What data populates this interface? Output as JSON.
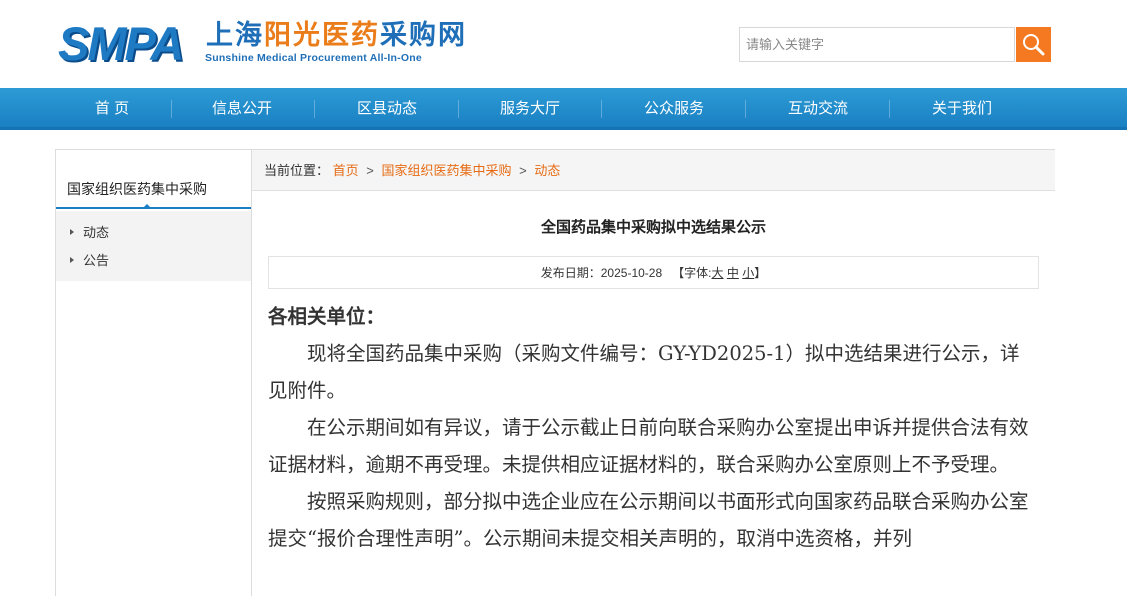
{
  "logo": {
    "abbr": "SMPA",
    "cn_part1": "上海",
    "cn_part2": "阳光医药",
    "cn_part3": "采购网",
    "en": "Sunshine Medical Procurement All-In-One"
  },
  "search": {
    "placeholder": "请输入关键字",
    "button_icon": "search-icon"
  },
  "nav": {
    "items": [
      "首 页",
      "信息公开",
      "区县动态",
      "服务大厅",
      "公众服务",
      "互动交流",
      "关于我们"
    ]
  },
  "sidebar": {
    "title": "国家组织医药集中采购",
    "items": [
      "动态",
      "公告"
    ]
  },
  "breadcrumb": {
    "label": "当前位置：",
    "items": [
      "首页",
      "国家组织医药集中采购",
      "动态"
    ],
    "separator": ">"
  },
  "article": {
    "title": "全国药品集中采购拟中选结果公示",
    "date_label": "发布日期：",
    "date": "2025-10-28",
    "font_label_open": "【字体:",
    "font_large": "大",
    "font_medium": "中",
    "font_small": "小",
    "font_label_close": "】",
    "salutation": "各相关单位：",
    "paragraphs": [
      "现将全国药品集中采购（采购文件编号：GY-YD2025-1）拟中选结果进行公示，详见附件。",
      "在公示期间如有异议，请于公示截止日前向联合采购办公室提出申诉并提供合法有效证据材料，逾期不再受理。未提供相应证据材料的，联合采购办公室原则上不予受理。",
      "按照采购规则，部分拟中选企业应在公示期间以书面形式向国家药品联合采购办公室提交“报价合理性声明”。公示期间未提交相关声明的，取消中选资格，并列"
    ]
  },
  "colors": {
    "nav_blue": "#1a80c2",
    "accent_orange": "#f47920",
    "link_orange": "#e66b14"
  }
}
